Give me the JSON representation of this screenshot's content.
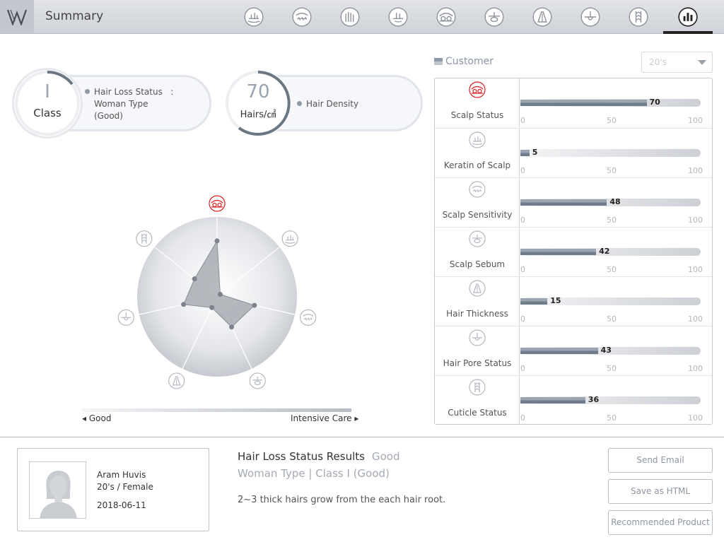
{
  "header": {
    "title": "Summary",
    "nav_icons": [
      "keratin-icon",
      "sensitivity-icon",
      "density-icon",
      "scalp-icon",
      "scalp-status-icon",
      "sebum-icon",
      "thickness-icon",
      "pore-icon",
      "cuticle-icon",
      "summary-chart-icon"
    ],
    "active_index": 9
  },
  "class_card": {
    "value": "I",
    "unit": "Class",
    "status_label": "Hair Loss Status",
    "status_sep": ":",
    "type_line1": "Woman Type",
    "type_line2": "(Good)"
  },
  "density_card": {
    "value": "70",
    "unit": "Hairs/㎠",
    "label": "Hair Density"
  },
  "customer": {
    "label": "Customer",
    "age_select": "20's"
  },
  "metrics": [
    {
      "name": "Scalp Status",
      "value": 70,
      "value_text": "70",
      "icon": "scalp-status-icon",
      "highlight": true
    },
    {
      "name": "Keratin of Scalp",
      "value": 5,
      "value_text": "5",
      "icon": "keratin-icon",
      "highlight": false
    },
    {
      "name": "Scalp Sensitivity",
      "value": 48,
      "value_text": "48",
      "icon": "sensitivity-icon",
      "highlight": false
    },
    {
      "name": "Scalp Sebum",
      "value": 42,
      "value_text": "42",
      "icon": "sebum-icon",
      "highlight": false
    },
    {
      "name": "Hair Thickness",
      "value": 15,
      "value_text": "15",
      "icon": "thickness-icon",
      "highlight": false
    },
    {
      "name": "Hair Pore Status",
      "value": 43,
      "value_text": "43",
      "icon": "pore-icon",
      "highlight": false
    },
    {
      "name": "Cuticle Status",
      "value": 36,
      "value_text": "36",
      "icon": "cuticle-icon",
      "highlight": false
    }
  ],
  "axis_ticks": [
    "0",
    "50",
    "100"
  ],
  "scale": {
    "good": "Good",
    "intensive": "Intensive Care"
  },
  "profile": {
    "name": "Aram Huvis",
    "age_gender": "20's / Female",
    "date": "2018-06-11"
  },
  "result": {
    "title": "Hair Loss Status Results",
    "status": "Good",
    "subtitle": "Woman Type | Class I (Good)",
    "description": "2~3 thick hairs grow from the each hair root."
  },
  "buttons": {
    "send_email": "Send Email",
    "save_html": "Save as HTML",
    "recommended": "Recommended Product"
  },
  "colors": {
    "highlight": "#e02020",
    "bar_fill": "#7a8896",
    "radar_fill": "#9ea1a8"
  }
}
